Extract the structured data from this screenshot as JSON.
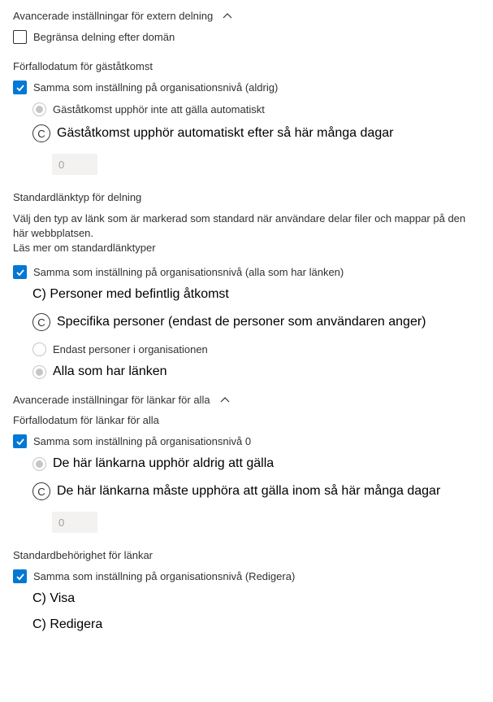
{
  "section1": {
    "title": "Avancerade inställningar för extern delning",
    "limit_label": "Begränsa delning efter domän"
  },
  "section2": {
    "title": "Förfallodatum för gäståtkomst",
    "same_label": "Samma som inställning på organisationsnivå (aldrig)",
    "opt1": "Gäståtkomst upphör inte att gälla automatiskt",
    "opt2": "Gäståtkomst upphör automatiskt efter så här många dagar",
    "input_value": "0"
  },
  "section3": {
    "title": "Standardlänktyp för delning",
    "desc": "Välj den typ av länk som är markerad som standard när användare delar filer och mappar på den här webbplatsen.",
    "link": "Läs mer om standardlänktyper",
    "same_label": "Samma som inställning på organisationsnivå (alla som har länken)",
    "opt1": "Personer med befintlig åtkomst",
    "opt2": "Specifika personer (endast de personer som användaren anger)",
    "opt3": "Endast personer i organisationen",
    "opt4": "Alla som har länken"
  },
  "section4": {
    "title": "Avancerade inställningar för länkar för alla"
  },
  "section5": {
    "title": "Förfallodatum för länkar för alla",
    "same_label": "Samma som inställning på organisationsnivå 0",
    "opt1": "De här länkarna upphör aldrig att gälla",
    "opt2": "De här länkarna måste upphöra att gälla inom så här många dagar",
    "input_value": "0"
  },
  "section6": {
    "title": "Standardbehörighet för länkar",
    "same_label": "Samma som inställning på organisationsnivå (Redigera)",
    "opt1": "Visa",
    "opt2": "Redigera"
  },
  "glyph_c": "C"
}
